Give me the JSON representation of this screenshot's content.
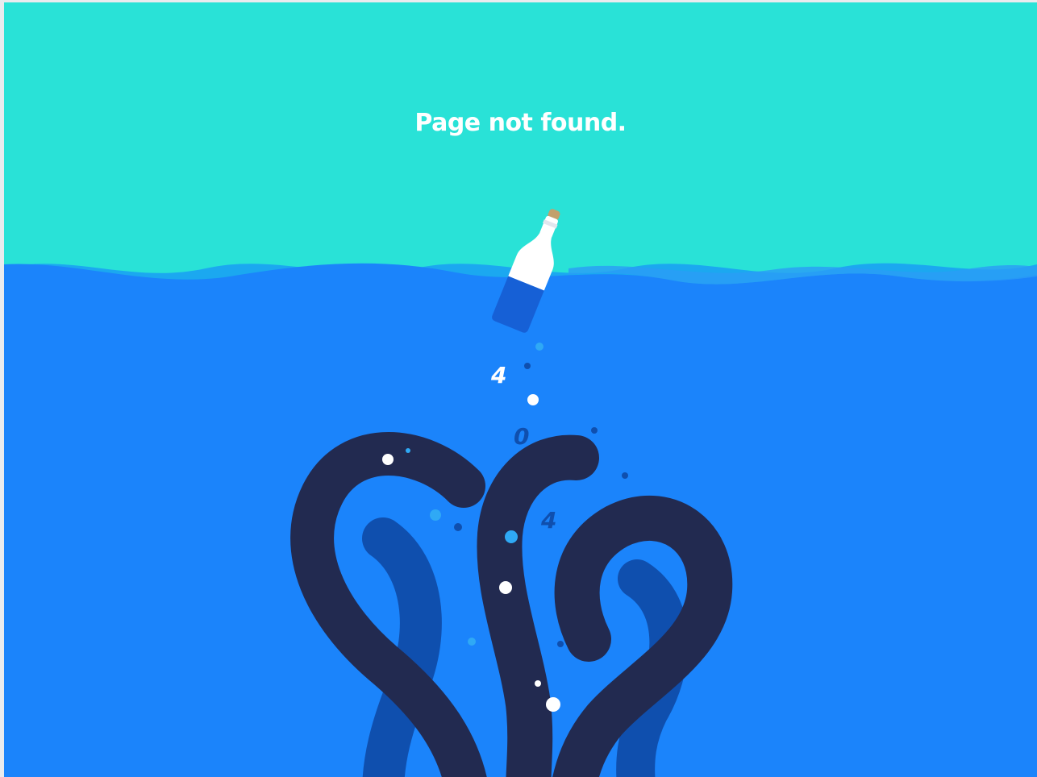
{
  "page": {
    "title": "Page not found."
  },
  "falling_digits": [
    "4",
    "0",
    "4"
  ],
  "colors": {
    "sky": "#29e2d7",
    "sea": "#1b84fb",
    "wave_back": "#1ba8f0",
    "wave_light": "#1f90f5",
    "tentacle_dark": "#222a50",
    "tentacle_back": "#0f4fae",
    "bottle": "#ffffff",
    "bottle_liquid": "#1660d6",
    "cork": "#c2a06c",
    "bubble_white": "#ffffff",
    "bubble_light": "#2fa9f5",
    "bubble_dark": "#0f4fae"
  },
  "icons": [
    "message-bottle-icon",
    "kraken-tentacles-illustration",
    "bubble-icon"
  ]
}
